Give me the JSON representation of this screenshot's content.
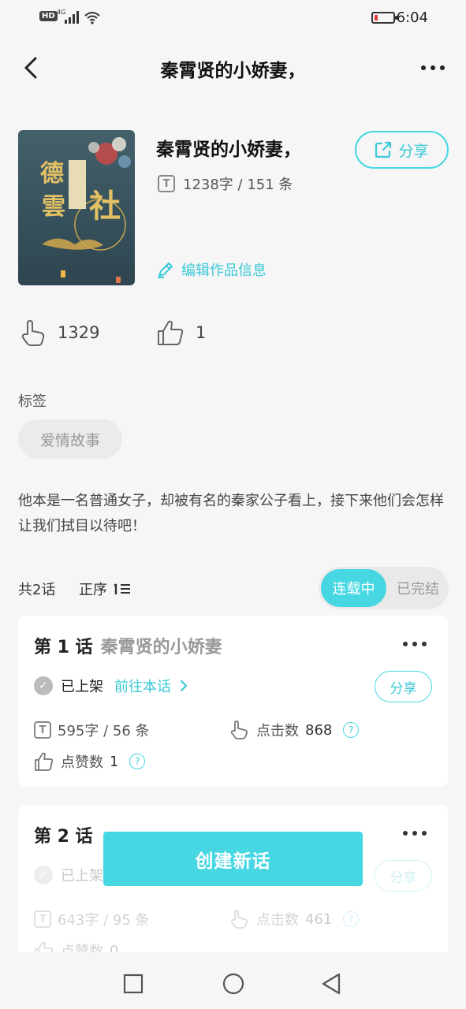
{
  "status_bar": {
    "hd": "HD",
    "network": "4G",
    "time": "6:04"
  },
  "header": {
    "title": "秦霄贤的小娇妻，"
  },
  "book": {
    "title": "秦霄贤的小娇妻，",
    "share_label": "分享",
    "word_count": "1238字 / 151 条",
    "edit_label": "编辑作品信息",
    "cover_text": [
      "德",
      "雲",
      "社"
    ]
  },
  "stats": {
    "clicks": "1329",
    "likes": "1"
  },
  "tags": {
    "label": "标签",
    "items": [
      "爱情故事"
    ]
  },
  "description": "他本是一名普通女子，却被有名的秦家公子看上，接下来他们会怎样让我们拭目以待吧！",
  "episodes_bar": {
    "count": "共2话",
    "order": "正序",
    "tab_active": "连载中",
    "tab_inactive": "已完结"
  },
  "episodes": [
    {
      "number": "第 1 话",
      "title": "秦霄贤的小娇妻",
      "status": "已上架",
      "goto": "前往本话",
      "share": "分享",
      "words": "595字 / 56 条",
      "clicks_label": "点击数",
      "clicks": "868",
      "likes_label": "点赞数",
      "likes": "1"
    },
    {
      "number": "第 2 话",
      "status": "已上架",
      "share": "分享",
      "words": "643字 / 95 条",
      "clicks_label": "点击数",
      "clicks": "461",
      "likes_label": "点赞数",
      "likes": "0"
    }
  ],
  "create_button": "创建新话",
  "colors": {
    "accent": "#47d7e3",
    "accent_text": "#3bc9d6",
    "background": "#f6f6f7"
  },
  "icons": [
    "back-arrow-icon",
    "more-icon",
    "share-icon",
    "text-icon",
    "pencil-icon",
    "click-hand-icon",
    "thumbs-up-icon",
    "order-list-icon",
    "check-icon",
    "chevron-right-icon",
    "question-icon"
  ]
}
